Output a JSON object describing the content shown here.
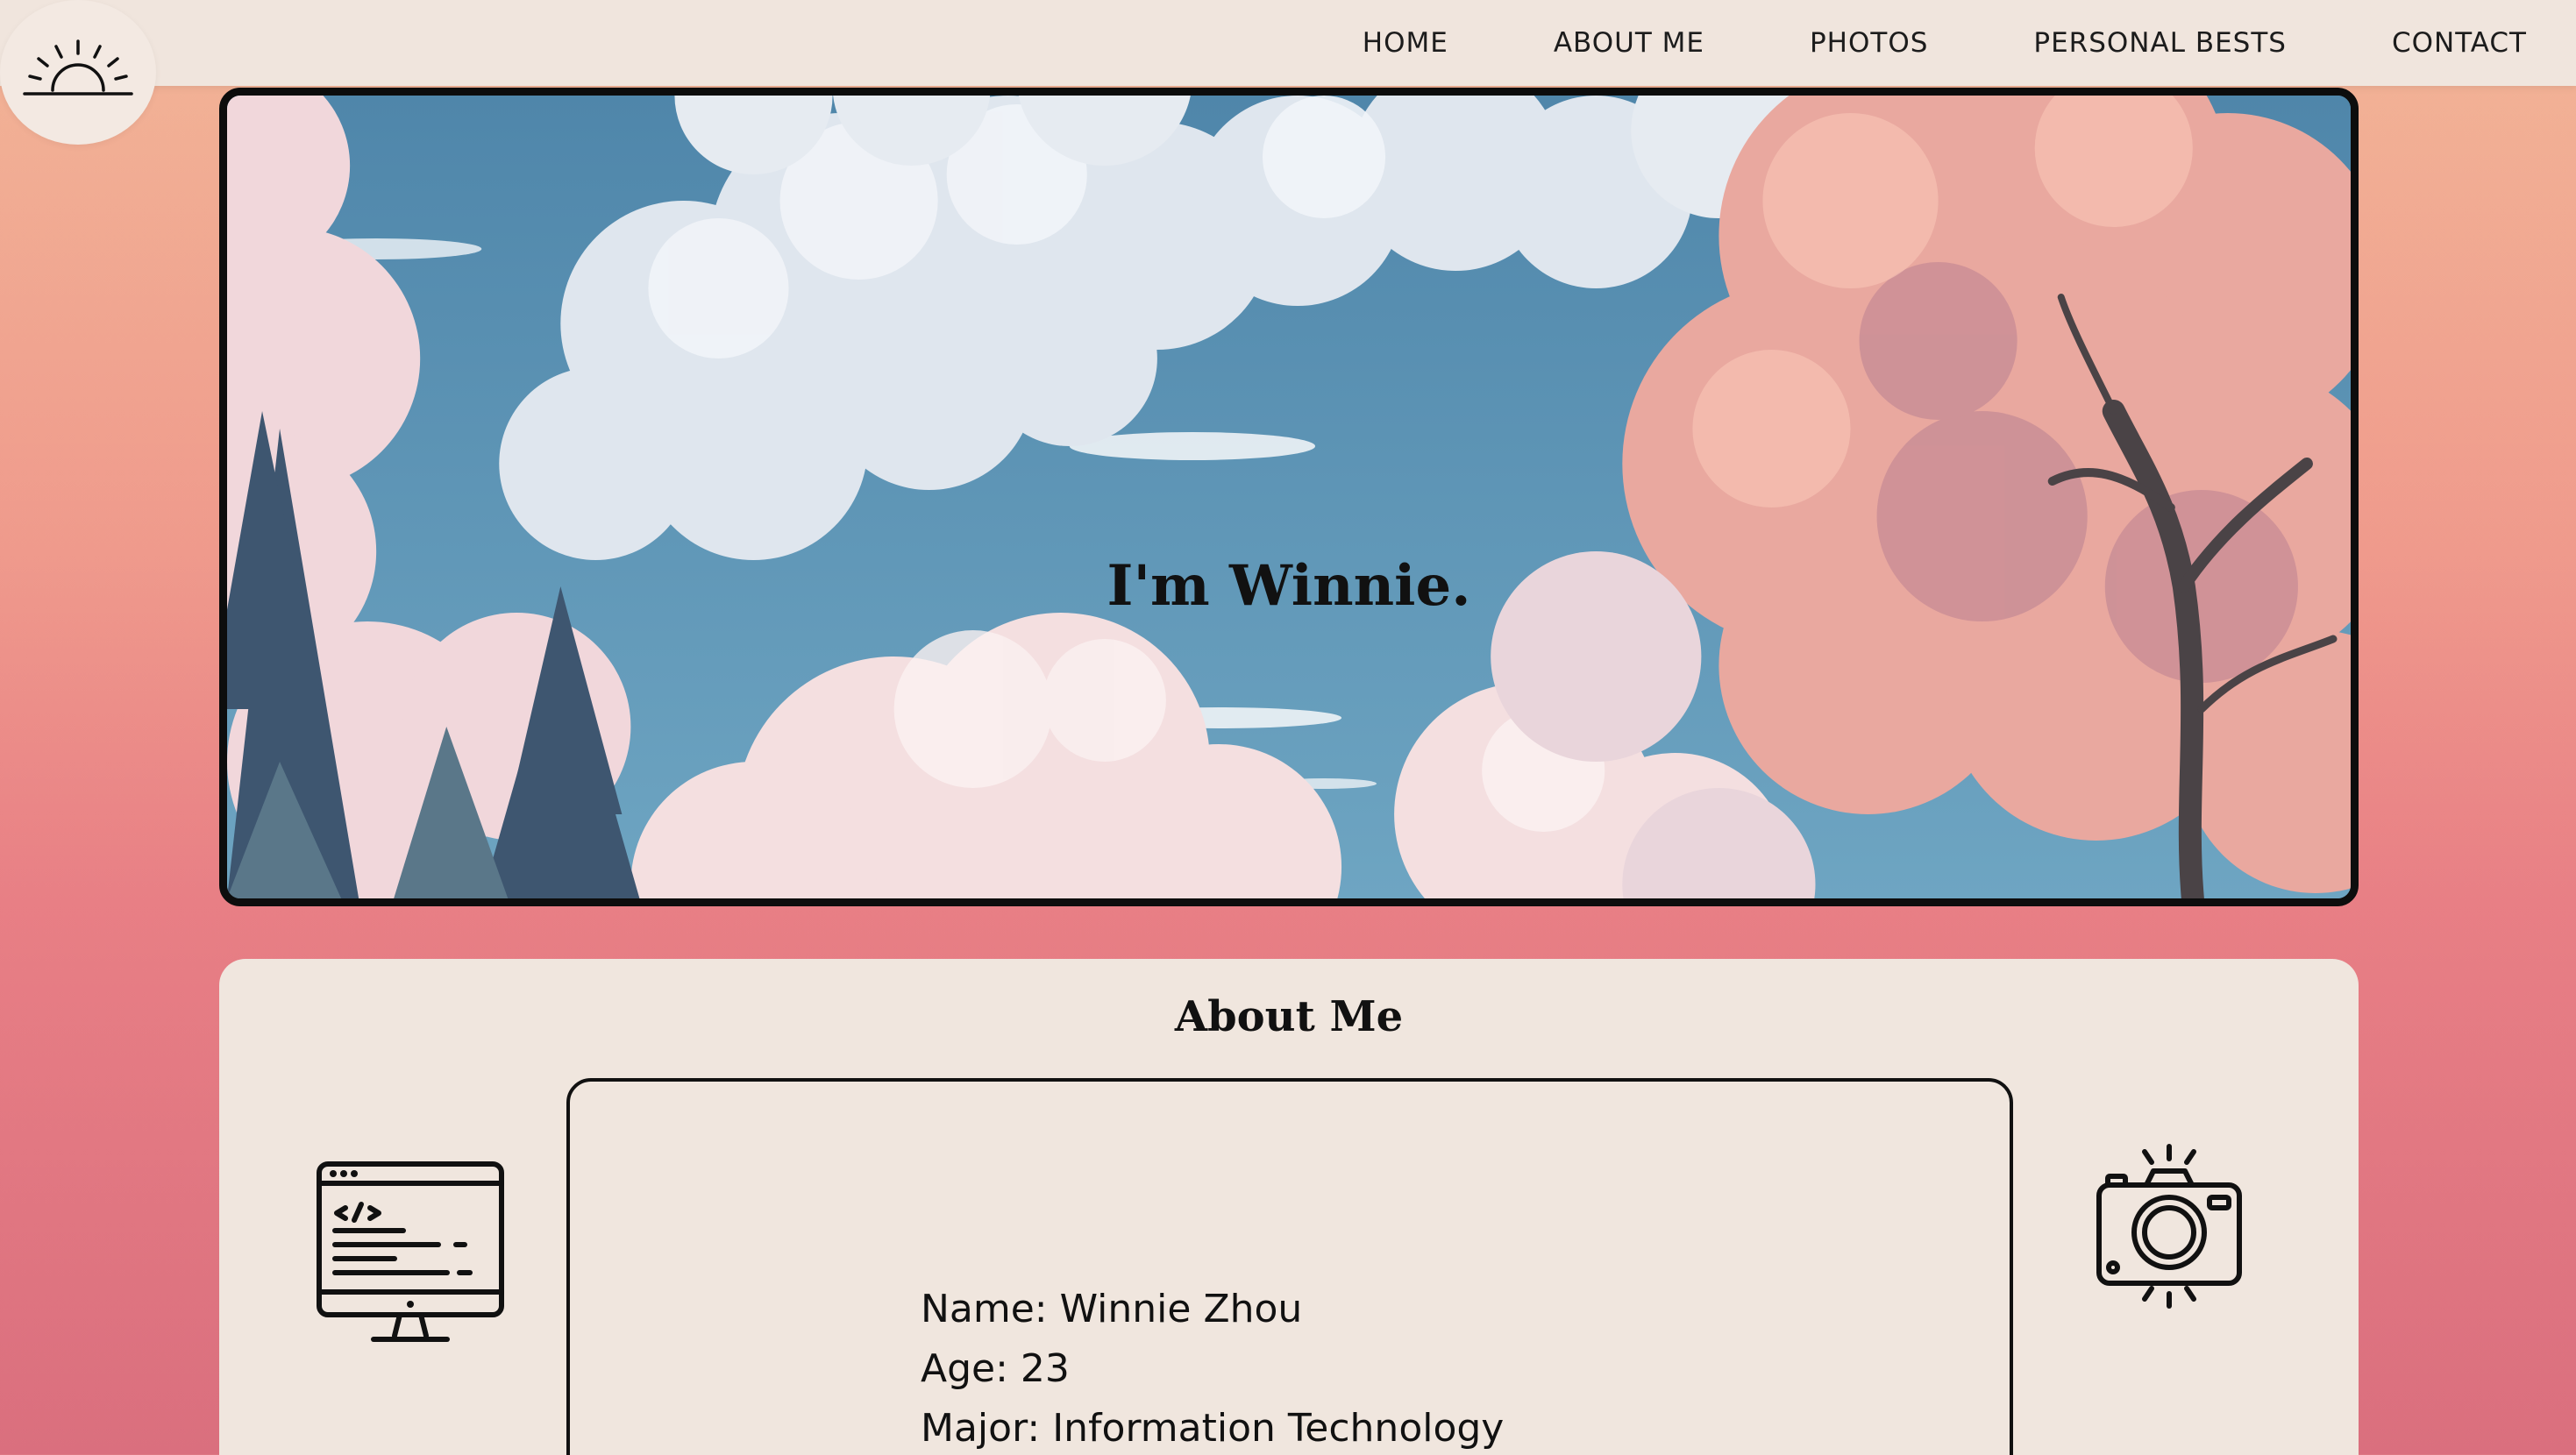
{
  "nav": {
    "logo_icon": "sunrise-icon",
    "links": [
      "HOME",
      "ABOUT ME",
      "PHOTOS",
      "PERSONAL BESTS",
      "CONTACT"
    ]
  },
  "hero": {
    "title": "I'm Winnie.",
    "background": "anime-sky-clouds-trees"
  },
  "about": {
    "title": "About Me",
    "left_icon": "computer-code-icon",
    "right_icon": "camera-icon",
    "lines": [
      "Name: Winnie Zhou",
      "Age: 23",
      "Major: Information Technology"
    ]
  },
  "colors": {
    "nav_bg": "#f0e5dd",
    "card_bg": "#f0e6de",
    "sky": "#5e95b4",
    "gradient_top": "#f2b597",
    "gradient_bottom": "#da6f7e"
  }
}
